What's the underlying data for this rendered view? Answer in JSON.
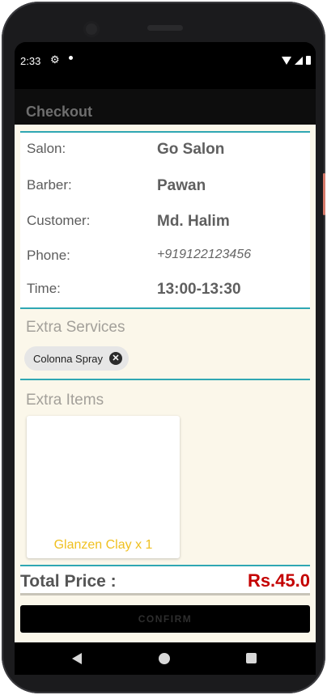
{
  "status_bar": {
    "time": "2:33"
  },
  "app_bar": {
    "title": "Checkout"
  },
  "details": {
    "salon_label": "Salon:",
    "salon_value": "Go Salon",
    "barber_label": "Barber:",
    "barber_value": "Pawan",
    "customer_label": "Customer:",
    "customer_value": "Md. Halim",
    "phone_label": "Phone:",
    "phone_value": "+919122123456",
    "time_label": "Time:",
    "time_value": "13:00-13:30"
  },
  "extra_services": {
    "title": "Extra Services",
    "chips": [
      {
        "label": "Colonna Spray"
      }
    ]
  },
  "extra_items": {
    "title": "Extra Items",
    "items": [
      {
        "label": "Glanzen Clay x 1"
      }
    ]
  },
  "total": {
    "label": "Total Price :",
    "value": "Rs.45.0"
  },
  "confirm_button": {
    "label": "CONFIRM"
  },
  "colors": {
    "accent_line": "#2fa7b3",
    "price": "#c40000",
    "item_label": "#f0c020",
    "content_bg": "#fbf7ea"
  },
  "icons": {
    "status": [
      "settings-gear-icon",
      "notification-dot-icon",
      "wifi-icon",
      "signal-icon",
      "battery-icon"
    ],
    "chip": "close-circle-icon",
    "navigation": [
      "back-icon",
      "home-icon",
      "recents-icon"
    ]
  }
}
